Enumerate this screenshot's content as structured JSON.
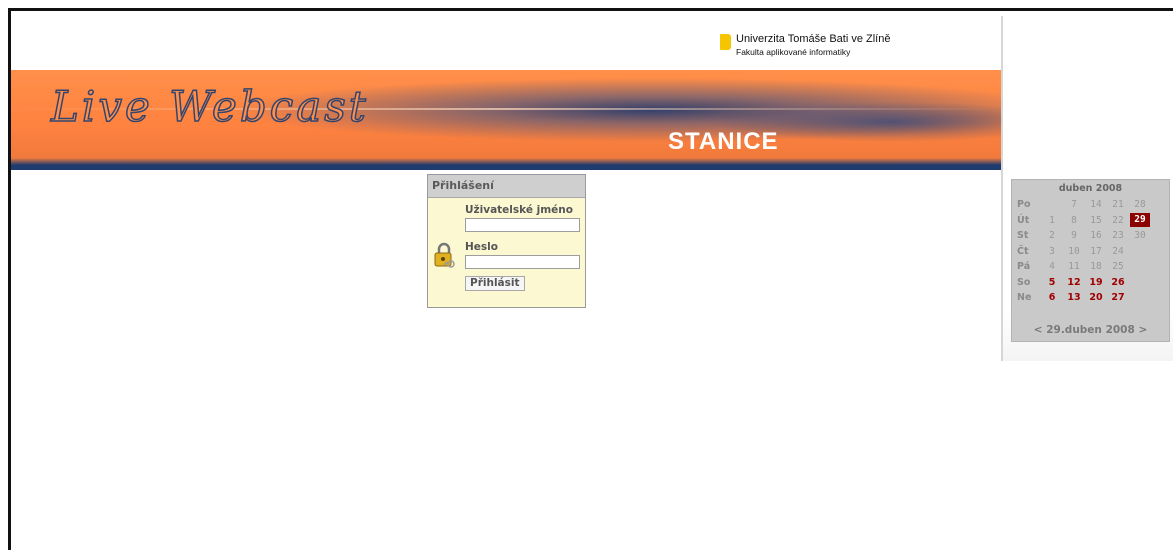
{
  "header": {
    "university_name": "Univerzita Tomáše Bati ve Zlíně",
    "faculty_name": "Fakulta aplikované informatiky"
  },
  "banner": {
    "title": "Live Webcast",
    "subtitle": "STANICE"
  },
  "login": {
    "title": "Přihlášení",
    "username_label": "Uživatelské jméno",
    "username_value": "",
    "password_label": "Heslo",
    "password_value": "",
    "submit_label": "Přihlásit"
  },
  "calendar": {
    "month_title": "duben 2008",
    "rows": [
      {
        "day": "Po",
        "dates": [
          "",
          "7",
          "14",
          "21",
          "28"
        ],
        "weekend": false
      },
      {
        "day": "Út",
        "dates": [
          "1",
          "8",
          "15",
          "22",
          "29"
        ],
        "weekend": false
      },
      {
        "day": "St",
        "dates": [
          "2",
          "9",
          "16",
          "23",
          "30"
        ],
        "weekend": false
      },
      {
        "day": "Čt",
        "dates": [
          "3",
          "10",
          "17",
          "24",
          ""
        ],
        "weekend": false
      },
      {
        "day": "Pá",
        "dates": [
          "4",
          "11",
          "18",
          "25",
          ""
        ],
        "weekend": false
      },
      {
        "day": "So",
        "dates": [
          "5",
          "12",
          "19",
          "26",
          ""
        ],
        "weekend": true
      },
      {
        "day": "Ne",
        "dates": [
          "6",
          "13",
          "20",
          "27",
          ""
        ],
        "weekend": true
      }
    ],
    "today": "29",
    "nav_prev": "<",
    "nav_current": "29.duben 2008",
    "nav_next": ">"
  },
  "colors": {
    "banner_orange": "#ff8240",
    "banner_blue": "#1f3c6e",
    "login_bg": "#fbf8d2",
    "calendar_bg": "#c9c9c9",
    "weekend_red": "#a00000",
    "today_bg": "#8b0000"
  },
  "icons": {
    "login": "padlock-icon",
    "university": "university-logo-mark"
  }
}
